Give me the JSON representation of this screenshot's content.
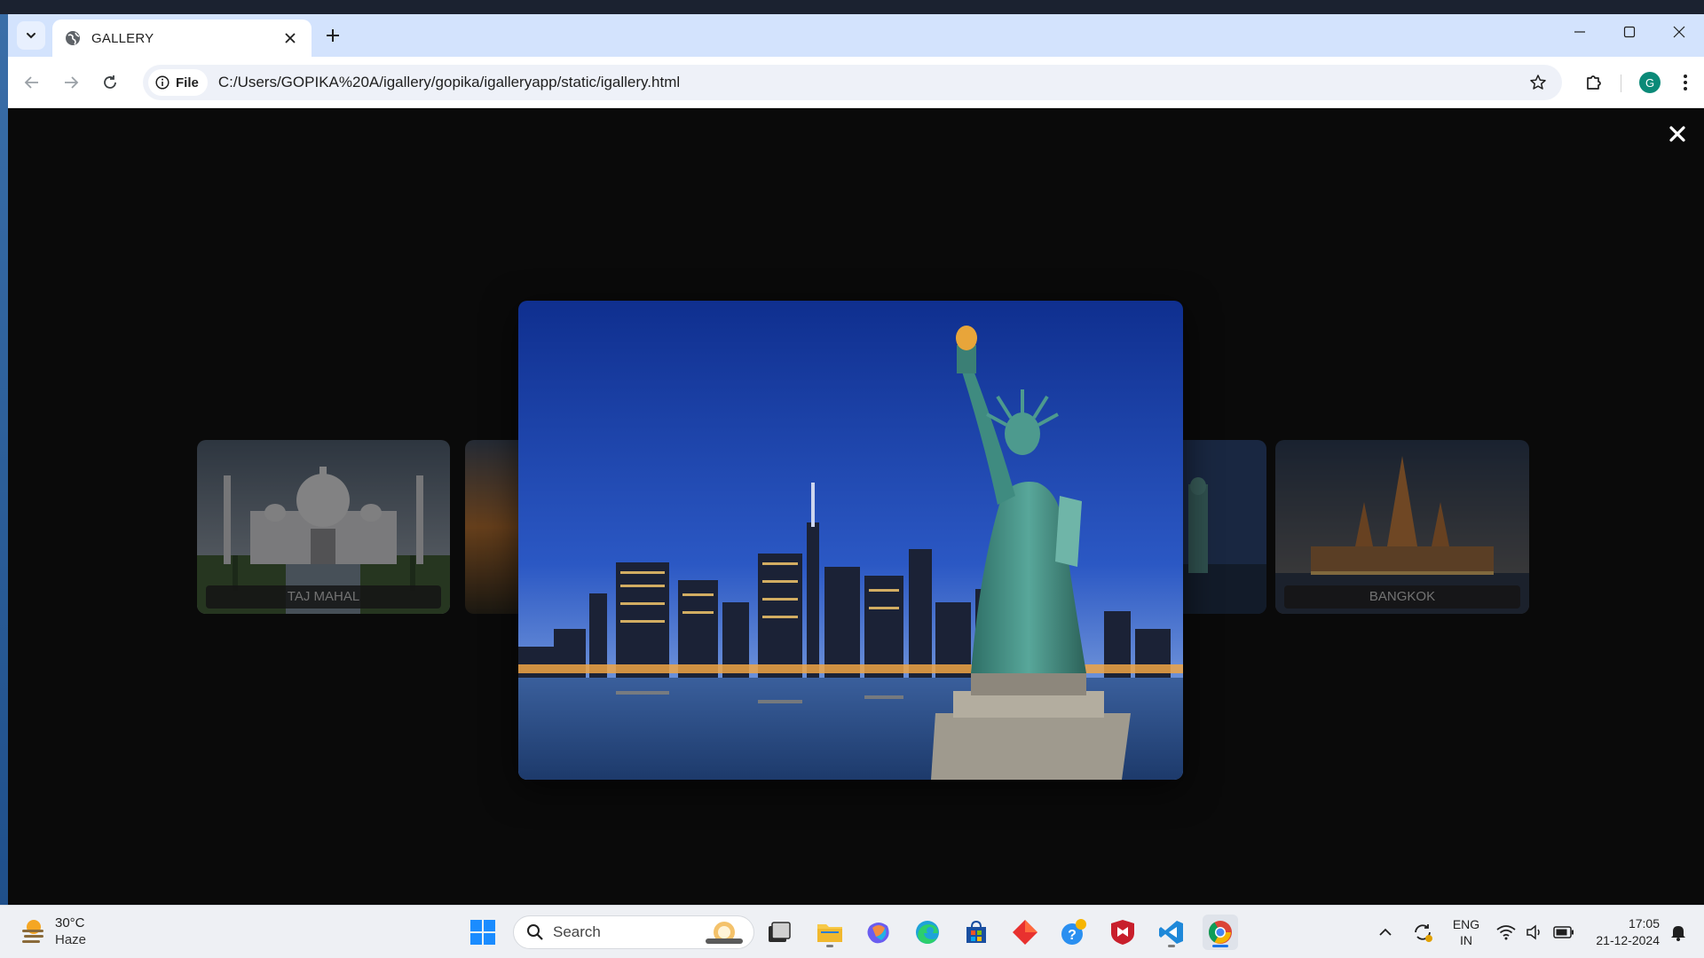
{
  "browser": {
    "tab_title": "GALLERY",
    "omnibox_chip": "File",
    "url": "C:/Users/GOPIKA%20A/igallery/gopika/igalleryapp/static/igallery.html",
    "profile_initial": "G"
  },
  "gallery": {
    "cards": [
      {
        "caption": "TAJ MAHAL"
      },
      {
        "caption": "BANGKOK"
      }
    ],
    "featured_image": "statue-of-liberty-new-york-skyline"
  },
  "taskbar": {
    "weather_temp": "30°C",
    "weather_condition": "Haze",
    "search_label": "Search",
    "lang_line1": "ENG",
    "lang_line2": "IN",
    "time": "17:05",
    "date": "21-12-2024"
  },
  "colors": {
    "tabstrip": "#d3e3fd",
    "page_background": "#0a0a0a",
    "avatar": "#0b8a78"
  }
}
